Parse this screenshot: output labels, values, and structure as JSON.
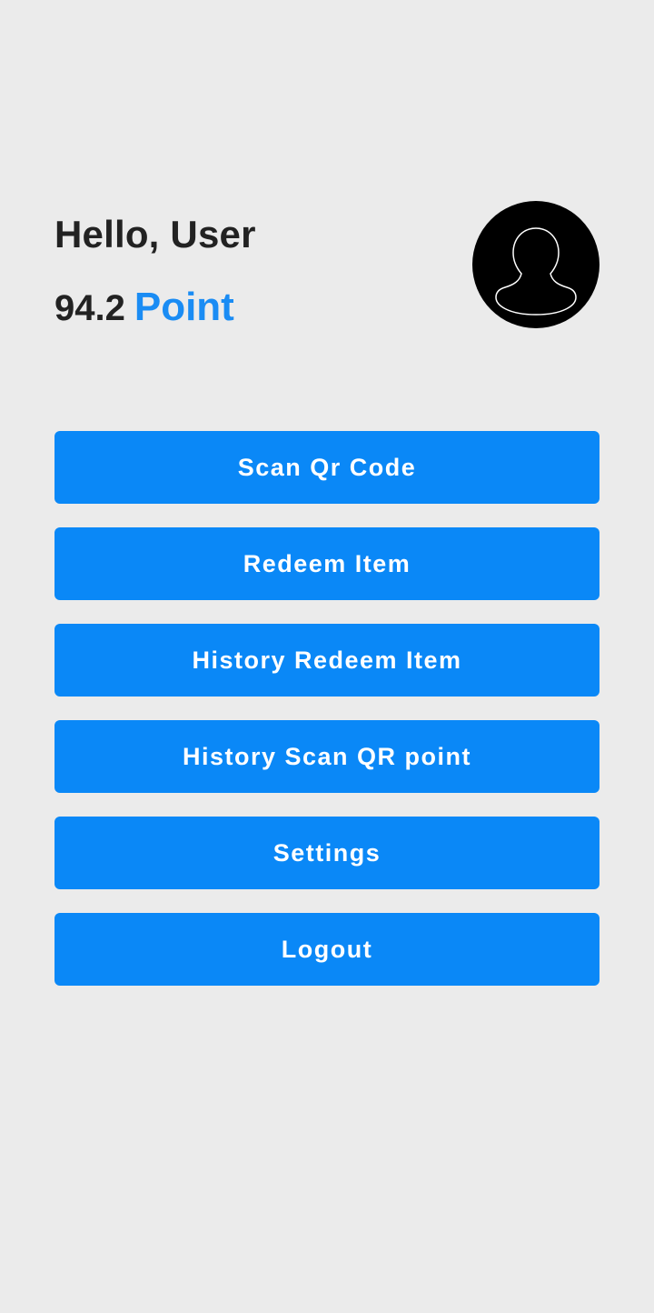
{
  "header": {
    "greeting": "Hello, User",
    "points_value": "94.2",
    "points_unit": "Point"
  },
  "avatar": {
    "icon": "user-avatar-icon"
  },
  "menu": {
    "buttons": [
      {
        "label": "Scan Qr Code"
      },
      {
        "label": "Redeem Item"
      },
      {
        "label": "History Redeem Item"
      },
      {
        "label": "History Scan QR point"
      },
      {
        "label": "Settings"
      },
      {
        "label": "Logout"
      }
    ]
  },
  "colors": {
    "background": "#ebebeb",
    "accent": "#0a88f7",
    "point_text": "#1a8cf4",
    "text_dark": "#222222"
  }
}
